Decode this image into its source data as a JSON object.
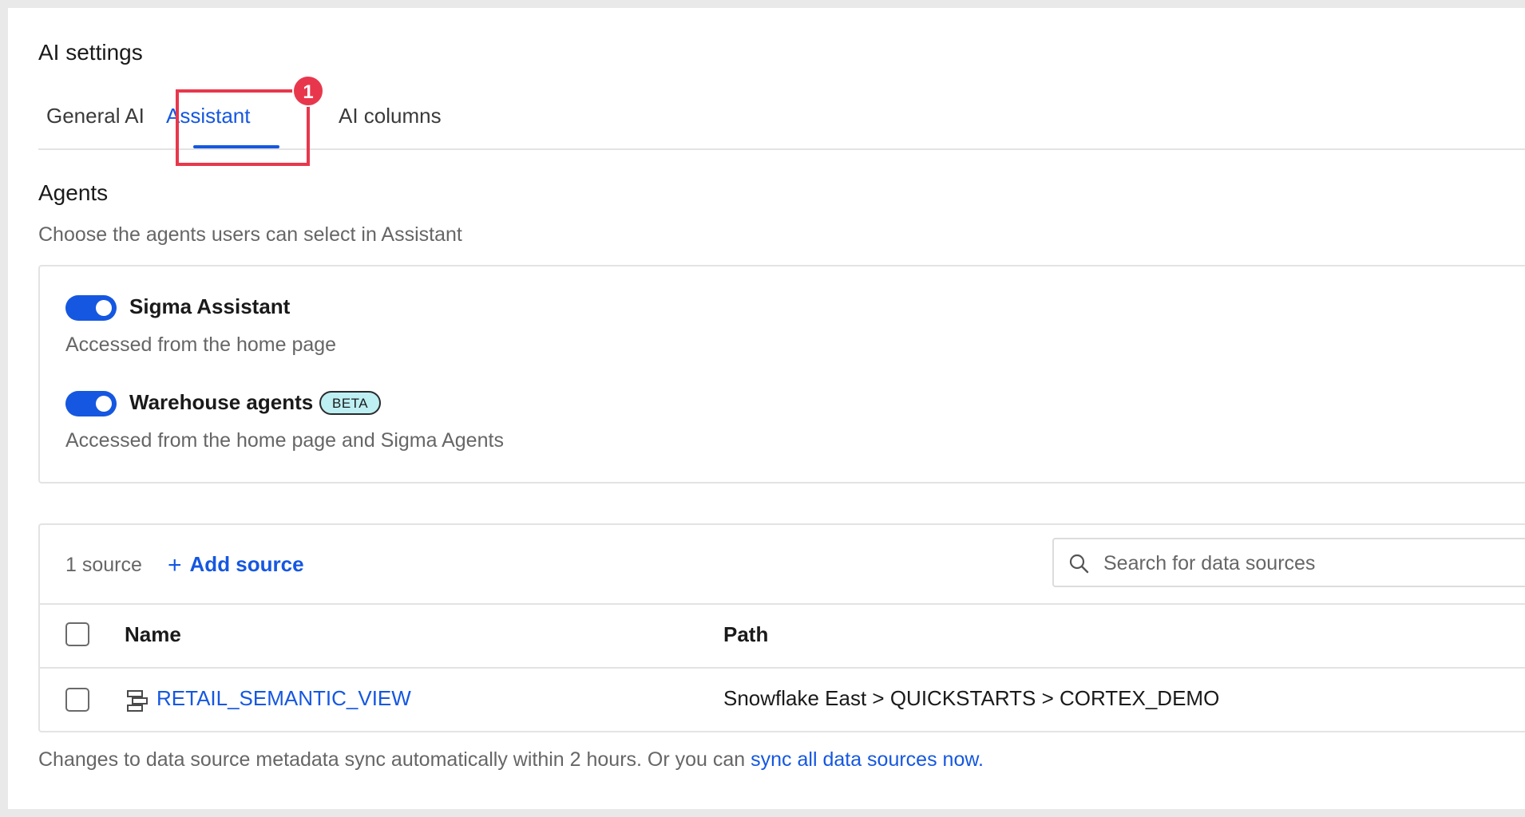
{
  "page": {
    "title": "AI settings"
  },
  "tabs": [
    {
      "label": "General AI",
      "active": false
    },
    {
      "label": "Assistant",
      "active": true
    },
    {
      "label": "AI columns",
      "active": false
    }
  ],
  "callout": {
    "number": "1",
    "color": "#e8374c"
  },
  "agents_section": {
    "heading": "Agents",
    "subtitle": "Choose the agents users can select in Assistant",
    "agents": [
      {
        "name": "Sigma Assistant",
        "description": "Accessed from the home page",
        "enabled": true
      },
      {
        "name": "Warehouse agents",
        "badge": "BETA",
        "description": "Accessed from the home page and Sigma Agents",
        "enabled": true
      }
    ]
  },
  "sources": {
    "count_label": "1 source",
    "add_label": "Add source",
    "add_icon": "plus-icon",
    "search": {
      "placeholder": "Search for data sources",
      "value": "",
      "icon": "search-icon"
    },
    "columns": [
      "Name",
      "Path"
    ],
    "rows": [
      {
        "name": "RETAIL_SEMANTIC_VIEW",
        "icon": "semantic-view-icon",
        "path": "Snowflake East > QUICKSTARTS > CORTEX_DEMO",
        "checked": false
      }
    ]
  },
  "footer": {
    "text": "Changes to data source metadata sync automatically within 2 hours. Or you can ",
    "link": "sync all data sources now."
  },
  "colors": {
    "accent": "#1557e0",
    "callout": "#e8374c",
    "beta_bg": "#bdeff3"
  }
}
